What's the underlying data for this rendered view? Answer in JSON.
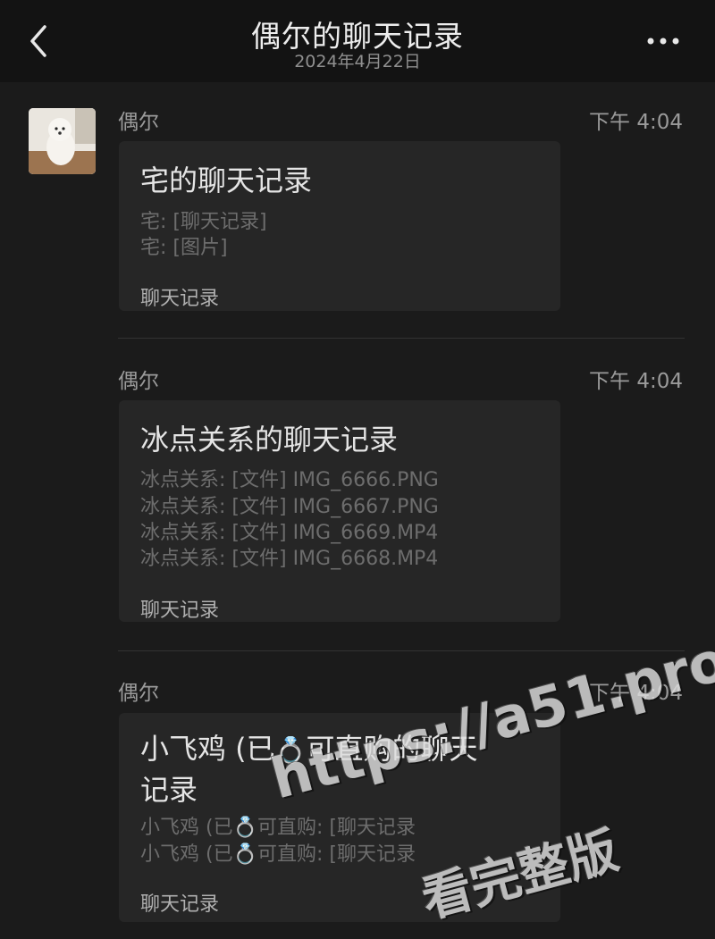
{
  "header": {
    "title": "偶尔的聊天记录",
    "date": "2024年4月22日"
  },
  "messages": [
    {
      "sender": "偶尔",
      "time": "下午 4:04",
      "card_title": "宅的聊天记录",
      "lines": [
        "宅: [聊天记录]",
        "宅: [图片]"
      ],
      "footer": "聊天记录"
    },
    {
      "sender": "偶尔",
      "time": "下午 4:04",
      "card_title": "冰点关系的聊天记录",
      "lines": [
        "冰点关系: [文件] IMG_6666.PNG",
        "冰点关系: [文件] IMG_6667.PNG",
        "冰点关系: [文件] IMG_6669.MP4",
        "冰点关系: [文件] IMG_6668.MP4"
      ],
      "footer": "聊天记录"
    },
    {
      "sender": "偶尔",
      "time": "下午 4:04",
      "card_title_part1": "小飞鸡 (已",
      "card_title_part2": "可直购的聊天",
      "card_title_part3": "记录",
      "lines_part1": [
        "小飞鸡 (已",
        "小飞鸡 (已"
      ],
      "lines_part2": [
        "可直购: [聊天记录",
        "可直购: [聊天记录"
      ],
      "footer": "聊天记录"
    }
  ],
  "emoji": {
    "ring": "💍"
  },
  "watermark": {
    "line1": "https://a51.pro",
    "line2": "看完整版"
  },
  "icons": {
    "back": "chevron-left-icon",
    "more": "more-dots-icon",
    "avatar": "dog-avatar"
  }
}
